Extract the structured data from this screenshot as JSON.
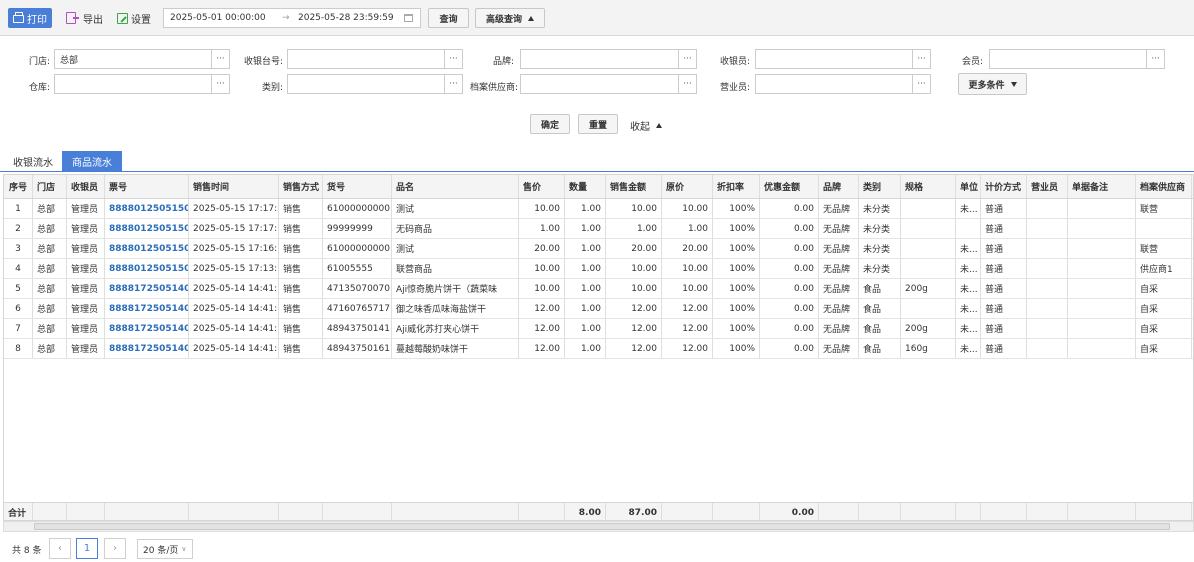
{
  "toolbar": {
    "print": "打印",
    "export": "导出",
    "settings": "设置",
    "date_start": "2025-05-01 00:00:00",
    "date_arrow": "→",
    "date_end": "2025-05-28 23:59:59",
    "query": "查询",
    "advanced_query": "高级查询"
  },
  "filters": {
    "store_label": "门店:",
    "store_value": "总部",
    "register_label": "收银台号:",
    "brand_label": "品牌:",
    "cashier_label": "收银员:",
    "member_label": "会员:",
    "warehouse_label": "仓库:",
    "category_label": "类别:",
    "supplier_label": "档案供应商:",
    "salesperson_label": "营业员:",
    "more_conditions": "更多条件",
    "dots": "···",
    "confirm": "确定",
    "reset": "重置",
    "collapse": "收起"
  },
  "tabs": [
    {
      "label": "收银流水"
    },
    {
      "label": "商品流水"
    }
  ],
  "table": {
    "headers": [
      "序号",
      "门店",
      "收银员",
      "票号",
      "销售时间",
      "销售方式",
      "货号",
      "品名",
      "售价",
      "数量",
      "销售金额",
      "原价",
      "折扣率",
      "优惠金额",
      "品牌",
      "类别",
      "规格",
      "单位",
      "计价方式",
      "营业员",
      "单据备注",
      "档案供应商"
    ],
    "rows": [
      [
        "1",
        "总部",
        "管理员",
        "8888012505150...",
        "2025-05-15 17:17:...",
        "销售",
        "61000000000...",
        "测试",
        "10.00",
        "1.00",
        "10.00",
        "10.00",
        "100%",
        "0.00",
        "无品牌",
        "未分类",
        "",
        "未...",
        "普通",
        "",
        "",
        "联营"
      ],
      [
        "2",
        "总部",
        "管理员",
        "8888012505150...",
        "2025-05-15 17:17:...",
        "销售",
        "99999999",
        "无码商品",
        "1.00",
        "1.00",
        "1.00",
        "1.00",
        "100%",
        "0.00",
        "无品牌",
        "未分类",
        "",
        "",
        "普通",
        "",
        "",
        ""
      ],
      [
        "3",
        "总部",
        "管理员",
        "8888012505150...",
        "2025-05-15 17:16:...",
        "销售",
        "61000000000...",
        "测试",
        "20.00",
        "1.00",
        "20.00",
        "20.00",
        "100%",
        "0.00",
        "无品牌",
        "未分类",
        "",
        "未...",
        "普通",
        "",
        "",
        "联营"
      ],
      [
        "4",
        "总部",
        "管理员",
        "8888012505150...",
        "2025-05-15 17:13:...",
        "销售",
        "61005555",
        "联营商品",
        "10.00",
        "1.00",
        "10.00",
        "10.00",
        "100%",
        "0.00",
        "无品牌",
        "未分类",
        "",
        "未...",
        "普通",
        "",
        "",
        "供应商1"
      ],
      [
        "5",
        "总部",
        "管理员",
        "8888172505140...",
        "2025-05-14 14:41:...",
        "销售",
        "47135070070...",
        "Aji惊奇脆片饼干（蔬菜味",
        "10.00",
        "1.00",
        "10.00",
        "10.00",
        "100%",
        "0.00",
        "无品牌",
        "食品",
        "200g",
        "未...",
        "普通",
        "",
        "",
        "自采"
      ],
      [
        "6",
        "总部",
        "管理员",
        "8888172505140...",
        "2025-05-14 14:41:...",
        "销售",
        "47160765717...",
        "御之味香瓜味海盐饼干",
        "12.00",
        "1.00",
        "12.00",
        "12.00",
        "100%",
        "0.00",
        "无品牌",
        "食品",
        "",
        "未...",
        "普通",
        "",
        "",
        "自采"
      ],
      [
        "7",
        "总部",
        "管理员",
        "8888172505140...",
        "2025-05-14 14:41:...",
        "销售",
        "48943750141...",
        "Aji威化苏打夹心饼干",
        "12.00",
        "1.00",
        "12.00",
        "12.00",
        "100%",
        "0.00",
        "无品牌",
        "食品",
        "200g",
        "未...",
        "普通",
        "",
        "",
        "自采"
      ],
      [
        "8",
        "总部",
        "管理员",
        "8888172505140...",
        "2025-05-14 14:41:...",
        "销售",
        "48943750161...",
        "蔓越莓酸奶味饼干",
        "12.00",
        "1.00",
        "12.00",
        "12.00",
        "100%",
        "0.00",
        "无品牌",
        "食品",
        "160g",
        "未...",
        "普通",
        "",
        "",
        "自采"
      ]
    ],
    "footer": {
      "label": "合计",
      "quantity": "8.00",
      "amount": "87.00",
      "discount": "0.00"
    }
  },
  "pager": {
    "total": "共 8 条",
    "prev": "‹",
    "page": "1",
    "next": "›",
    "page_size": "20 条/页"
  },
  "colors": {
    "accent": "#4a7fd8",
    "link": "#2a6db8"
  }
}
